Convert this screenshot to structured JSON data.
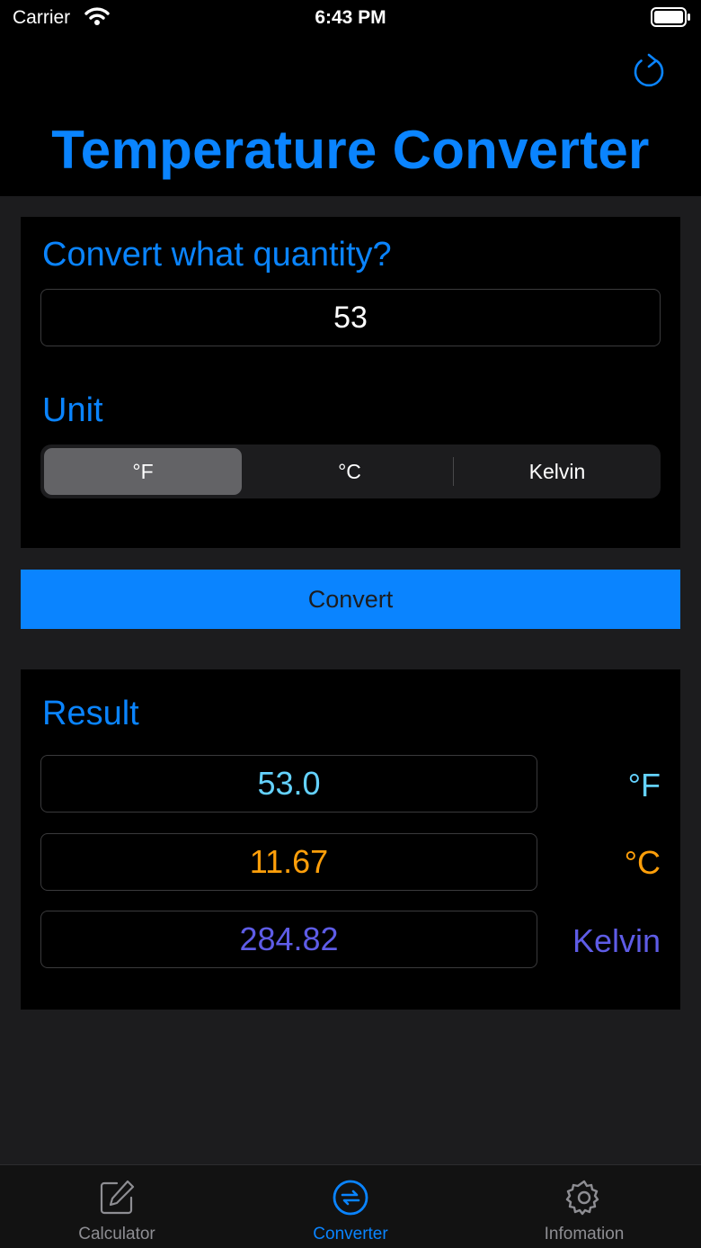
{
  "status_bar": {
    "carrier": "Carrier",
    "time": "6:43 PM"
  },
  "header": {
    "title": "Temperature Converter"
  },
  "input": {
    "label": "Convert what quantity?",
    "value": "53",
    "unit_label": "Unit",
    "units": [
      "°F",
      "°C",
      "Kelvin"
    ],
    "selected_unit": "°F"
  },
  "convert_button": {
    "label": "Convert"
  },
  "result": {
    "label": "Result",
    "rows": [
      {
        "value": "53.0",
        "unit": "°F",
        "color": "#64d2ff"
      },
      {
        "value": "11.67",
        "unit": "°C",
        "color": "#ff9f0a"
      },
      {
        "value": "284.82",
        "unit": "Kelvin",
        "color": "#5e5ce6"
      }
    ]
  },
  "tabbar": {
    "items": [
      {
        "label": "Calculator",
        "icon": "pencil-square-icon",
        "active": false
      },
      {
        "label": "Converter",
        "icon": "arrows-circle-icon",
        "active": true
      },
      {
        "label": "Infomation",
        "icon": "gear-icon",
        "active": false
      }
    ]
  },
  "colors": {
    "accent": "#0a84ff",
    "inactive": "#8e8e93"
  }
}
